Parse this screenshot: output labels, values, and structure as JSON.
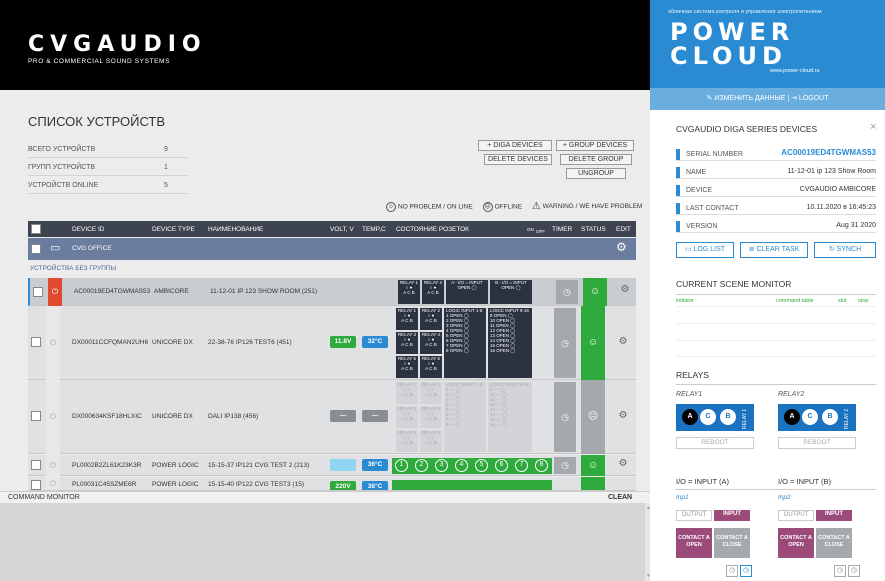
{
  "brand": {
    "logo": "CVGAUDIO",
    "tagline": "PRO & COMMERCIAL SOUND SYSTEMS"
  },
  "page": {
    "title": "СПИСОК УСТРОЙСТВ"
  },
  "stats": [
    {
      "label": "ВСЕГО УСТРОЙСТВ",
      "value": "9"
    },
    {
      "label": "ГРУПП УСТРОЙСТВ",
      "value": "1"
    },
    {
      "label": "УСТРОЙСТВ ONLINE",
      "value": "5"
    }
  ],
  "actions": {
    "add_diga": "+ DIGA DEVICES",
    "add_group": "+ GROUP DEVICES",
    "delete_devices": "DELETE DEVICES",
    "delete_group": "DELETE GROUP",
    "ungroup": "UNGROUP"
  },
  "legend": {
    "ok": "NO PROBLEM / ON LINE",
    "offline": "OFFLINE",
    "warn": "WARNING / WE HAVE PROBLEM"
  },
  "table": {
    "headers": {
      "id": "DEVICE ID",
      "type": "DEVICE TYPE",
      "name": "НАИМЕНОВАНИЕ",
      "volt": "VOLT, V",
      "temp": "TEMP,C",
      "sockets": "СОСТОЯНИЕ РОЗЕТОК",
      "on": "ON",
      "off": "OFF",
      "timer": "TIMER",
      "status": "STATUS",
      "edit": "EDIT"
    },
    "group": "CVG OFFICE",
    "section": "УСТРОЙСТВА БЕЗ ГРУППЫ",
    "rows": [
      {
        "id": "AC00019ED4TGWMAS53",
        "type": "AMBICORE",
        "name": "11-12-01 IP 123 SHOW ROOM (251)"
      },
      {
        "id": "DX00011CCFQMAN2UH6",
        "type": "UNICORE DX",
        "name": "22-38-76 IP126 TEST6 (451)",
        "volt": "11.8V",
        "temp": "32°C"
      },
      {
        "id": "DX000634KSF18HLXIC",
        "type": "UNICORE DX",
        "name": "DALI IP138 (456)",
        "volt": "—",
        "temp": "—"
      },
      {
        "id": "PL0002B2ZL61K23K3R",
        "type": "POWER LOGIC",
        "name": "15-15-37 IP121 CVG TEST 2 (213)",
        "volt": "—",
        "temp": "36°C"
      },
      {
        "id": "PL00031C45SZME6R",
        "type": "POWER LOGIC",
        "name": "15-15-40 IP122 CVG TEST3 (15)",
        "volt": "220V",
        "temp": "36°C"
      }
    ],
    "relay": {
      "r1": "RELAY 1",
      "r2": "RELAY 2",
      "r3": "RELAY 3",
      "r4": "RELAY 4",
      "r5": "RELAY 5",
      "r6": "RELAY 6",
      "a_input": "A - I/O = INPUT",
      "b_input": "B - I/O = INPUT",
      "open": "OPEN",
      "li1": "LOGIC INPUT 1-8",
      "li2": "LOGIC INPUT 9-16"
    }
  },
  "command_monitor": {
    "title": "COMMAND MONITOR",
    "clean": "CLEAN"
  },
  "panel": {
    "tagline": "облачная система контроля и управления электропитанием",
    "brand1": "POWER",
    "brand2": "CLOUD",
    "site": "www.power-cloud.ru",
    "edit": "ИЗМЕНИТЬ ДАННЫЕ",
    "logout": "LOGOUT",
    "devices_title": "CVGAUDIO DIGA SERIES DEVICES",
    "info": [
      {
        "label": "SERIAL NUMBER",
        "value": "AC00019ED4TGWMAS53"
      },
      {
        "label": "NAME",
        "value": "11-12-01 ip 123 Show Room"
      },
      {
        "label": "DEVICE",
        "value": "CVGAUDIO AMBICORE"
      },
      {
        "label": "LAST CONTACT",
        "value": "10.11.2020 в 16:45:23"
      },
      {
        "label": "VERSION",
        "value": "Aug 31 2020"
      }
    ],
    "log_list": "LOG LIST",
    "clear_task": "CLEAR TASK",
    "synch": "SYNCH",
    "scene_title": "CURRENT SCENE MONITOR",
    "scene_cols": {
      "initiator": "initiator",
      "command": "command table",
      "slot": "slot",
      "stop": "stop"
    },
    "relays_title": "RELAYS",
    "relay1": "RELAY1",
    "relay2": "RELAY2",
    "relay1_tag": "RELAY 1",
    "relay2_tag": "RELAY 2",
    "reboot": "REBOOT",
    "io_a": "I/O = INPUT (A)",
    "io_b": "I/O = INPUT (B)",
    "inp1": "Inp1",
    "inp2": "Inp2",
    "output": "OUTPUT",
    "input": "INPUT",
    "contact_open": "CONTACT A OPEN",
    "contact_close": "CONTACT A CLOSE"
  },
  "colors": {
    "accent": "#2a8bd2",
    "green": "#2faa3c",
    "red": "#e04a2f",
    "purple": "#9c4a7a"
  }
}
